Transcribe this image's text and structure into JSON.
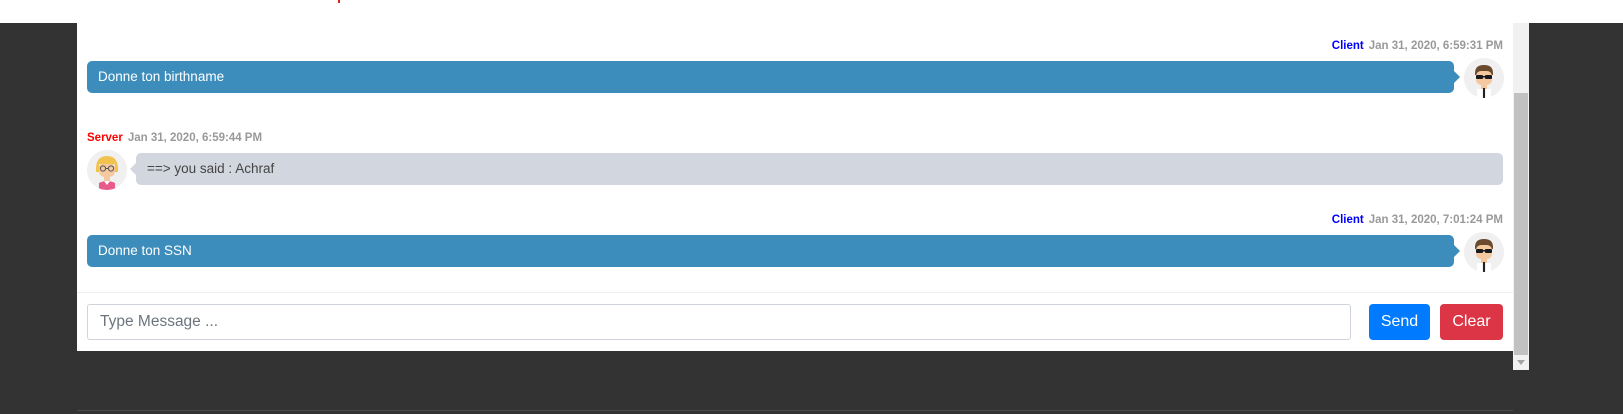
{
  "colors": {
    "client_name": "#0000ff",
    "server_name": "#ff0000",
    "client_bubble": "#3c8dbc",
    "server_bubble": "#d2d6de",
    "send_button": "#007bff",
    "clear_button": "#dc3545",
    "background": "#333333"
  },
  "messages": [
    {
      "sender": "Client",
      "timestamp": "Jan 31, 2020, 6:59:31 PM",
      "text": "Donne ton birthname",
      "avatar_icon": "man-sunglasses-avatar-icon"
    },
    {
      "sender": "Server",
      "timestamp": "Jan 31, 2020, 6:59:44 PM",
      "text": "==> you said : Achraf",
      "avatar_icon": "woman-glasses-avatar-icon"
    },
    {
      "sender": "Client",
      "timestamp": "Jan 31, 2020, 7:01:24 PM",
      "text": "Donne ton SSN",
      "avatar_icon": "man-sunglasses-avatar-icon"
    }
  ],
  "composer": {
    "value": "",
    "placeholder": "Type Message ...",
    "send_label": "Send",
    "clear_label": "Clear"
  }
}
